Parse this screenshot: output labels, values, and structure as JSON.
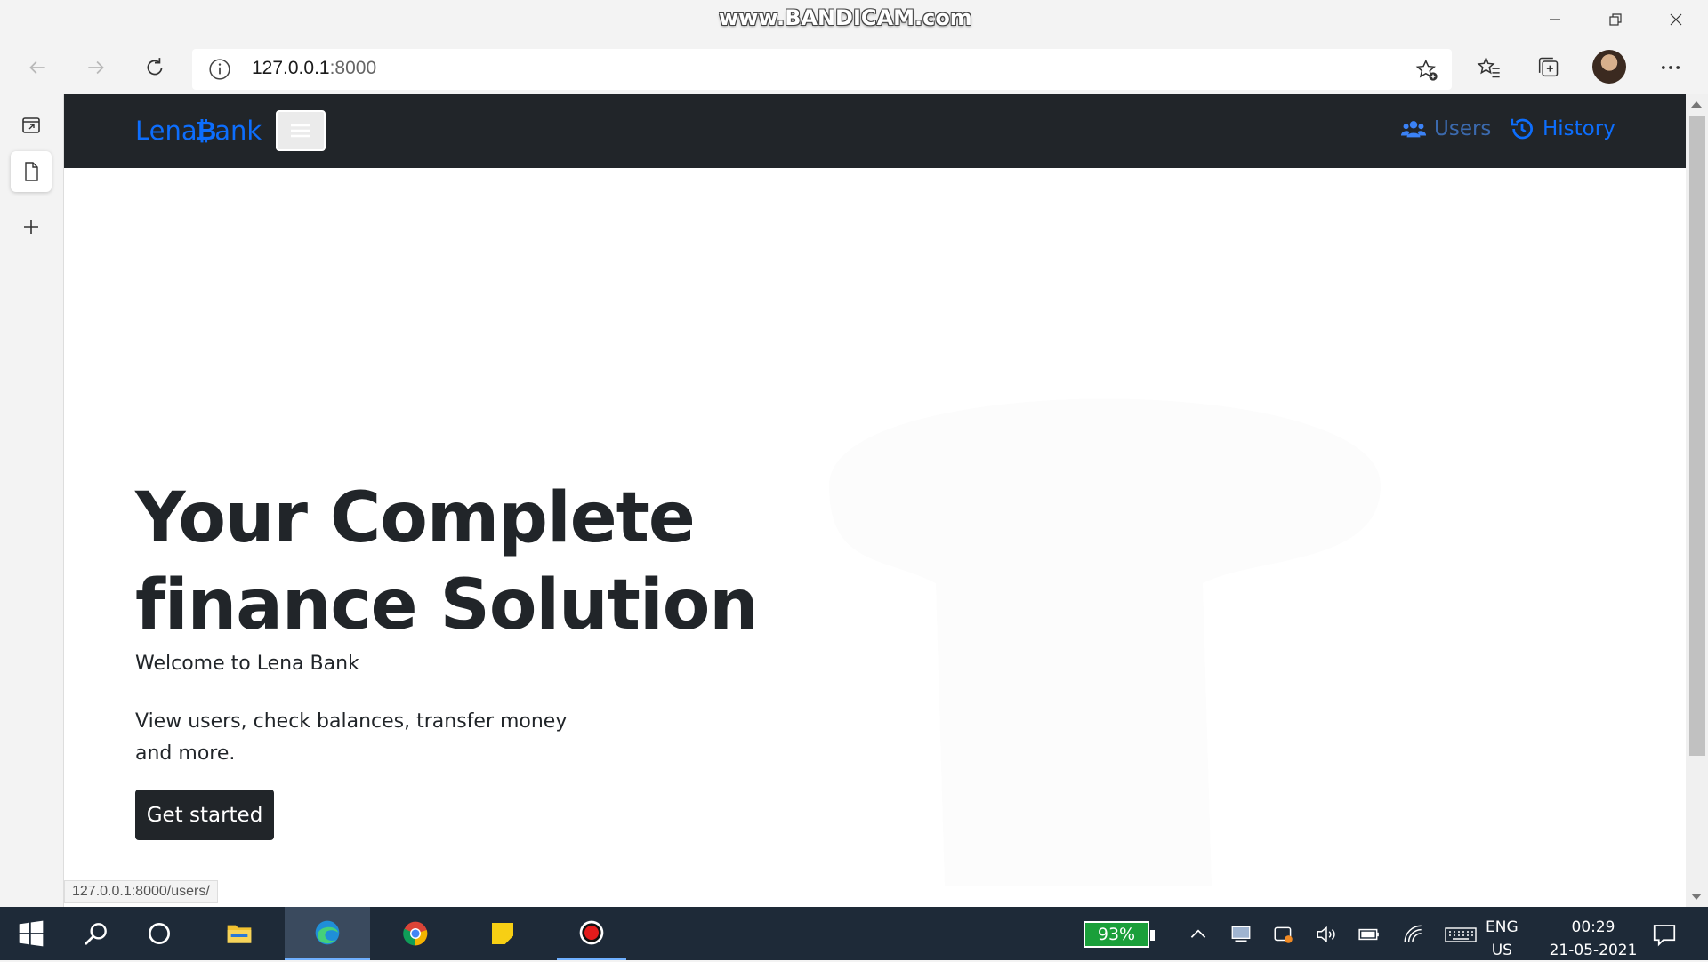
{
  "watermark": "www.BANDICAM.com",
  "browser": {
    "url_host": "127.0.0.1",
    "url_port": ":8000",
    "status_url": "127.0.0.1:8000/users/"
  },
  "site": {
    "brand_prefix": "Lena",
    "brand_symbol": "₿",
    "brand_suffix": "ank",
    "nav": {
      "users": "Users",
      "history": "History"
    },
    "hero": {
      "title_line1": "Your Complete",
      "title_line2": "finance Solution",
      "subtitle": "Welcome to Lena Bank",
      "description": "View users, check balances, transfer money and more.",
      "cta": "Get started"
    },
    "colors": {
      "navbar_bg": "#212529",
      "link": "#0d6efd",
      "button_bg": "#212529"
    }
  },
  "taskbar": {
    "battery": "93%",
    "lang_line1": "ENG",
    "lang_line2": "US",
    "time": "00:29",
    "date": "21-05-2021"
  }
}
